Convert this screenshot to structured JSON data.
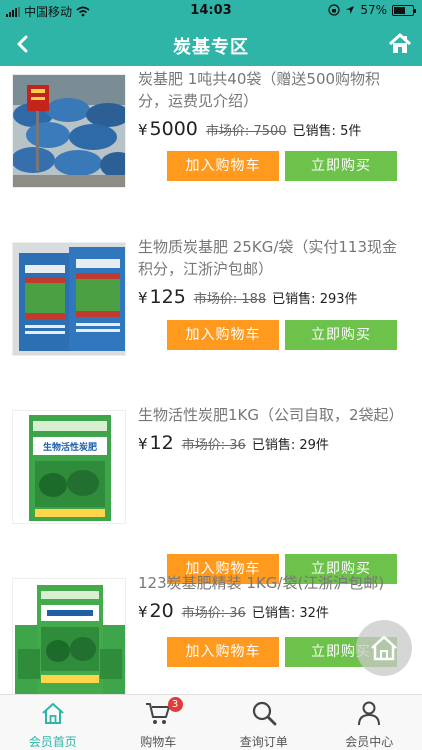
{
  "status_bar": {
    "carrier": "中国移动",
    "time": "14:03",
    "battery": "57%"
  },
  "header": {
    "title": "炭基专区"
  },
  "labels": {
    "yen": "¥",
    "market_prefix": "市场价:",
    "sold_prefix": "已销售:",
    "add_to_cart": "加入购物车",
    "buy_now": "立即购买"
  },
  "products": [
    {
      "name": "炭基肥 1吨共40袋（赠送500购物积分，运费见介绍）",
      "price": "5000",
      "market_price": "7500",
      "sold": "5件"
    },
    {
      "name": "生物质炭基肥 25KG/袋（实付113现金积分，江浙沪包邮）",
      "price": "125",
      "market_price": "188",
      "sold": "293件"
    },
    {
      "name": "生物活性炭肥1KG（公司自取，2袋起）",
      "price": "12",
      "market_price": "36",
      "sold": "29件"
    },
    {
      "name": "123炭基肥精装 1KG/袋(江浙沪包邮)",
      "price": "20",
      "market_price": "36",
      "sold": "32件"
    }
  ],
  "image_text": {
    "bag_label": "生物活性炭肥"
  },
  "tabbar": {
    "items": [
      {
        "label": "会员首页",
        "icon": "home-icon"
      },
      {
        "label": "购物车",
        "icon": "cart-icon",
        "badge": "3"
      },
      {
        "label": "查询订单",
        "icon": "search-icon"
      },
      {
        "label": "会员中心",
        "icon": "user-icon"
      }
    ]
  },
  "colors": {
    "theme": "#2fb5a8",
    "cart_button": "#ff9a1f",
    "buy_button": "#6cc24a",
    "badge": "#e23b3b"
  }
}
